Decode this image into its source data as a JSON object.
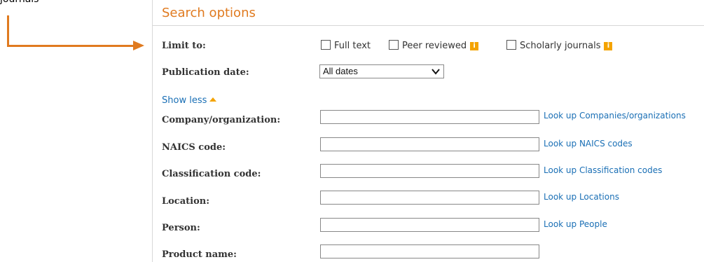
{
  "annotation": {
    "text": "journals",
    "color": "#e07a1f"
  },
  "panel": {
    "title": "Search options",
    "limit_label": "Limit to:",
    "checkboxes": [
      {
        "label": "Full text",
        "checked": false,
        "info": false
      },
      {
        "label": "Peer reviewed",
        "checked": false,
        "info": true
      },
      {
        "label": "Scholarly journals",
        "checked": false,
        "info": true
      }
    ],
    "info_icon_glyph": "i",
    "publication_date": {
      "label": "Publication date:",
      "value": "All dates"
    },
    "show_less": "Show less",
    "fields": [
      {
        "label": "Company/organization:",
        "lookup": "Look up Companies/organizations"
      },
      {
        "label": "NAICS code:",
        "lookup": "Look up NAICS codes"
      },
      {
        "label": "Classification code:",
        "lookup": "Look up Classification codes"
      },
      {
        "label": "Location:",
        "lookup": "Look up Locations"
      },
      {
        "label": "Person:",
        "lookup": "Look up People"
      },
      {
        "label": "Product name:",
        "lookup": ""
      }
    ]
  },
  "colors": {
    "accent": "#e07a1f",
    "link": "#1a6fb5",
    "info": "#f4a300"
  }
}
